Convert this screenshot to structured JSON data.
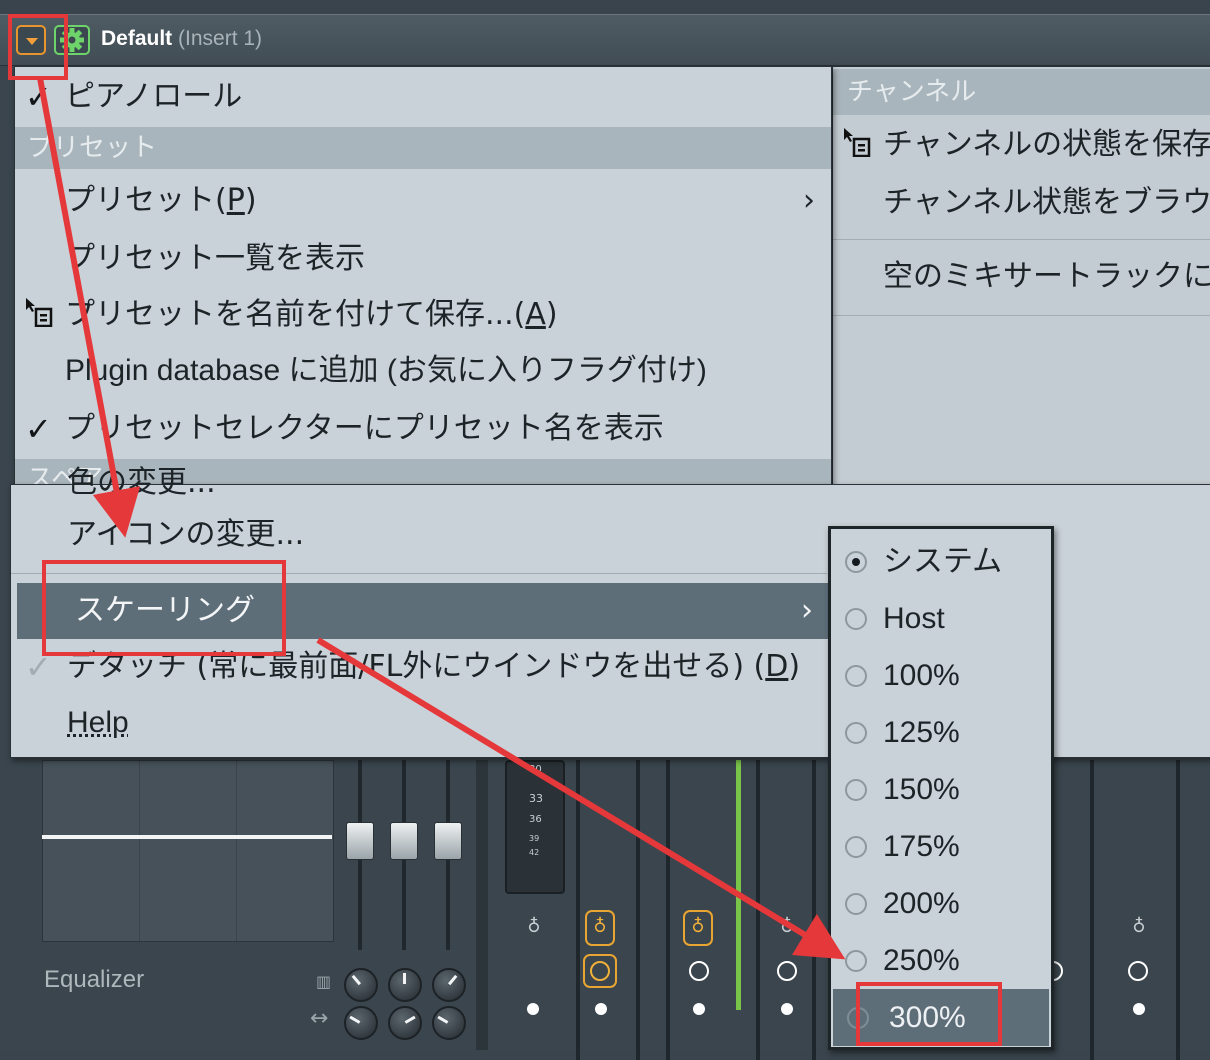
{
  "titlebar": {
    "preset_name": "Default",
    "insert_label": "(Insert 1)"
  },
  "main_menu": {
    "piano_roll": {
      "label": "ピアノロール",
      "checked": true
    },
    "preset_section": "プリセット",
    "presets": "プリセット(",
    "presets_key": "P",
    "presets_end": ")",
    "show_preset_list": "プリセット一覧を表示",
    "save_preset_as": "プリセットを名前を付けて保存...(",
    "save_preset_as_key": "A",
    "save_preset_as_end": ")",
    "add_to_plugin_db": "Plugin database に追加 (お気に入りフラグ付け)",
    "show_preset_name": {
      "label": "プリセットセレクターにプリセット名を表示",
      "checked": true
    },
    "spare_section": "スペア...",
    "change_color": "色の変更...",
    "change_icon": "アイコンの変更...",
    "scaling": "スケーリング",
    "detach": "デタッチ (常に最前面/FL外にウインドウを出せる) (",
    "detach_key": "D",
    "detach_end": ")",
    "help": "Help"
  },
  "channel_menu": {
    "section": "チャンネル",
    "save_channel_state": "チャンネルの状態を保存",
    "browse_channel_state": "チャンネル状態をブラウ",
    "empty_mixer_track": "空のミキサートラックに"
  },
  "scaling_menu": {
    "options": [
      {
        "label": "システム",
        "selected": true
      },
      {
        "label": "Host",
        "selected": false
      },
      {
        "label": "100%",
        "selected": false
      },
      {
        "label": "125%",
        "selected": false
      },
      {
        "label": "150%",
        "selected": false
      },
      {
        "label": "175%",
        "selected": false
      },
      {
        "label": "200%",
        "selected": false
      },
      {
        "label": "250%",
        "selected": false
      },
      {
        "label": "300%",
        "selected": false
      }
    ]
  },
  "background": {
    "eq_label": "Equalizer",
    "meter_values": [
      "30",
      "33",
      "36",
      "39",
      "42"
    ]
  },
  "colors": {
    "accent_orange": "#e8952d",
    "accent_green": "#6ed36a",
    "annotation_red": "#e5383b",
    "menu_bg": "#c9d2d8",
    "menu_highlight": "#5e6e79"
  }
}
